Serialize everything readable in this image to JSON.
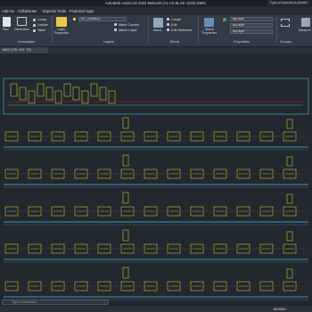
{
  "titlebar": {
    "title": "Autodesk AutoCAD 2022  Mekanik (A1-A2 BLOK 1530).DWG",
    "search_placeholder": "Type a keyword or phrase"
  },
  "tabs": [
    "Add-ins",
    "Collaborate",
    "Express Tools",
    "Featured Apps"
  ],
  "ribbon": {
    "text_label": "Text",
    "dimension_label": "Dimension",
    "linear_label": "Linear",
    "leader_label": "Leader",
    "table_label": "Table",
    "annotation_title": "Annotation",
    "layer_properties_label": "Layer Properties",
    "layers_title": "Layers",
    "layer_combo_value": "MT_SEMBOL",
    "make_current_label": "Make Current",
    "match_layer_label": "Match Layer",
    "insert_label": "Insert",
    "create_label": "Create",
    "edit_label": "Edit",
    "edit_attributes_label": "Edit Attributes",
    "block_title": "Block",
    "match_properties_label": "Match Properties",
    "bylayer_1": "ByLayer",
    "bylayer_2": "ByLayer",
    "bylayer_3": "ByLayer",
    "properties_title": "Properties",
    "groups_title": "Groups",
    "measure_label": "Measure"
  },
  "doc_tab": "MAZ (YEL GN. TE)",
  "command": {
    "placeholder": "Type a command"
  },
  "status": {
    "model": "MODEL"
  },
  "colors": {
    "accent_yellow": "#f0e020",
    "rail_cyan": "#3fc3d6",
    "red": "#e02020"
  }
}
